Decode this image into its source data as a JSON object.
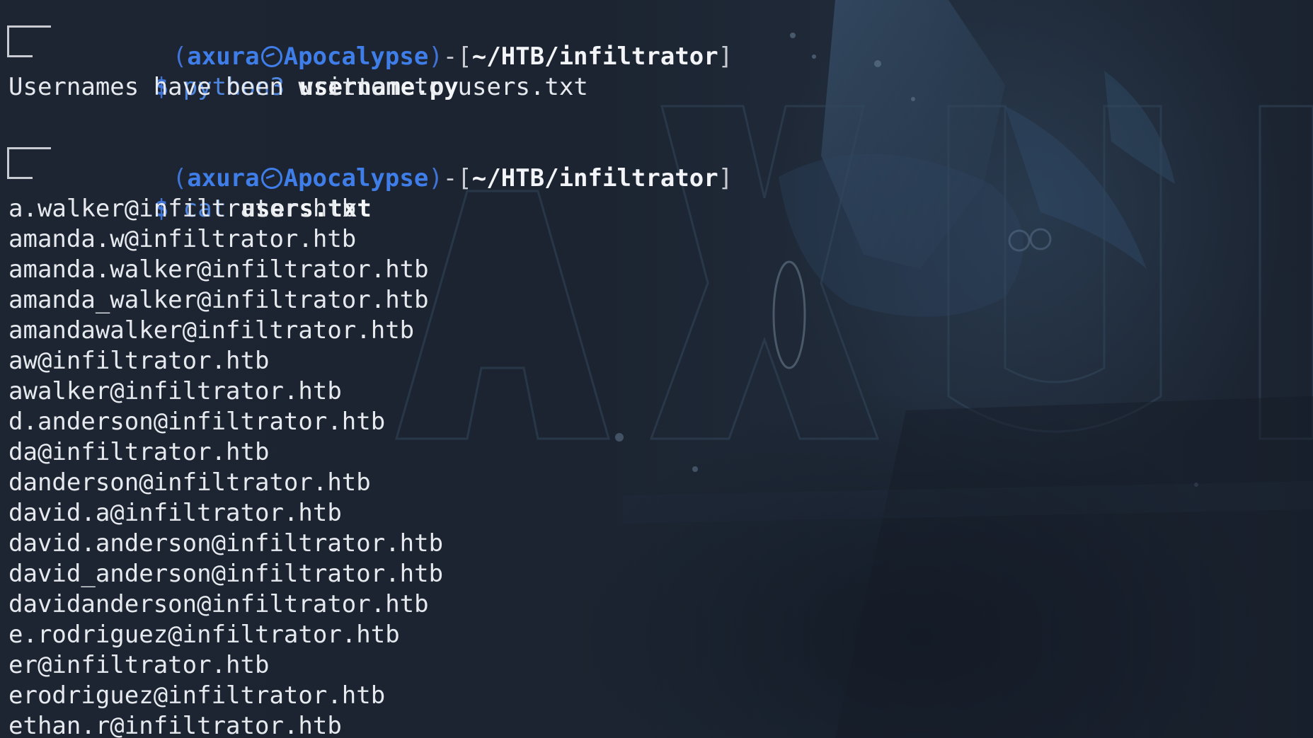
{
  "prompt": {
    "open_paren": "(",
    "user": "axura",
    "host": "Apocalypse",
    "close_paren": ")",
    "separator": "-[",
    "path": "~/HTB/infiltrator",
    "close_bracket": "]",
    "dollar": "$"
  },
  "commands": [
    {
      "exe": "python3",
      "arg": "username.py",
      "output": [
        "Usernames have been written to users.txt"
      ]
    },
    {
      "exe": "cat",
      "arg": "users.txt",
      "output": [
        "a.walker@infiltrator.htb",
        "amanda.w@infiltrator.htb",
        "amanda.walker@infiltrator.htb",
        "amanda_walker@infiltrator.htb",
        "amandawalker@infiltrator.htb",
        "aw@infiltrator.htb",
        "awalker@infiltrator.htb",
        "d.anderson@infiltrator.htb",
        "da@infiltrator.htb",
        "danderson@infiltrator.htb",
        "david.a@infiltrator.htb",
        "david.anderson@infiltrator.htb",
        "david_anderson@infiltrator.htb",
        "davidanderson@infiltrator.htb",
        "e.rodriguez@infiltrator.htb",
        "er@infiltrator.htb",
        "erodriguez@infiltrator.htb",
        "ethan.r@infiltrator.htb"
      ]
    }
  ],
  "wallpaper": {
    "watermark_text": "AXUI",
    "colors": {
      "prompt_blue": "#3f7de8",
      "text": "#e6e9ee",
      "background": "#1c2431"
    }
  }
}
